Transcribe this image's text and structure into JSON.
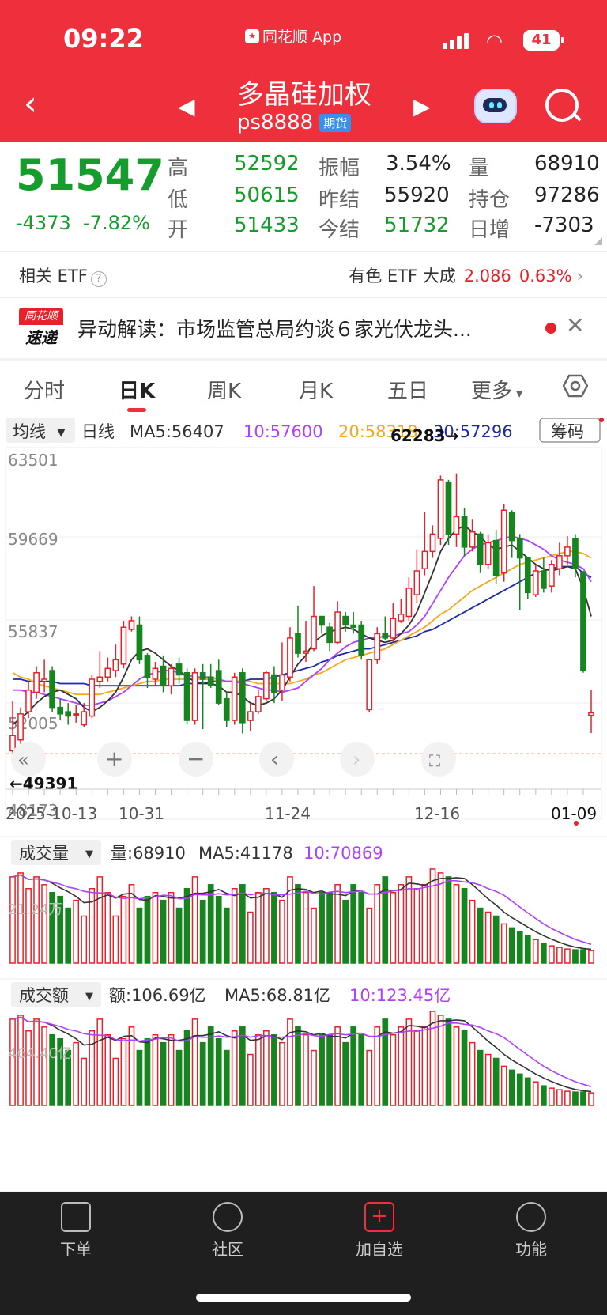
{
  "status": {
    "time": "09:22",
    "app": "同花顺 App",
    "battery": "41"
  },
  "header": {
    "title": "多晶硅加权",
    "code": "ps8888",
    "badge": "期货"
  },
  "quote": {
    "price": "51547",
    "change": "-4373",
    "pct": "-7.82%",
    "rows": [
      {
        "l1": "高",
        "v1": "52592",
        "l2": "振幅",
        "v2": "3.54%",
        "l3": "量",
        "v3": "68910"
      },
      {
        "l1": "低",
        "v1": "50615",
        "l2": "昨结",
        "v2": "55920",
        "l3": "持仓",
        "v3": "97286"
      },
      {
        "l1": "开",
        "v1": "51433",
        "l2": "今结",
        "v2": "51732",
        "l3": "日增",
        "v3": "-7303"
      }
    ]
  },
  "etf": {
    "label": "相关 ETF",
    "name": "有色 ETF 大成",
    "price": "2.086",
    "pct": "0.63%"
  },
  "news": {
    "logo_top": "同花顺",
    "logo_bottom": "速递",
    "text": "异动解读：市场监管总局约谈６家光伏龙头..."
  },
  "tabs": [
    "分时",
    "日K",
    "周K",
    "月K",
    "五日",
    "更多"
  ],
  "ma_bar": {
    "selector": "均线",
    "kind": "日线",
    "ma5": "MA5:56407",
    "ma10": "10:57600",
    "ma20": "20:58318",
    "ma30": "30:57296",
    "chip": "筹码"
  },
  "axis": {
    "y_top": "63501",
    "y2": "59669",
    "y3": "55837",
    "y4": "52005",
    "y_bottom": "48173",
    "hi_label": "62283→",
    "lo_label": "←49391",
    "dates": [
      "2025-10-13",
      "10-31",
      "11-24",
      "12-16",
      "01-09"
    ]
  },
  "volume": {
    "selector": "成交量",
    "value": "量:68910",
    "ma5": "MA5:41178",
    "ma10": "10:70869",
    "scale": "21.24万"
  },
  "amount": {
    "selector": "成交额",
    "value": "额:106.69亿",
    "ma5": "MA5:68.81亿",
    "ma10": "10:123.45亿",
    "scale": "464.40亿"
  },
  "bottom": [
    "下单",
    "社区",
    "加自选",
    "功能"
  ],
  "colors": {
    "up": "#e8202a",
    "down": "#17851f",
    "ma5": "#333333",
    "ma10": "#b040ff",
    "ma20": "#f4a81d",
    "ma30": "#1c2aa8"
  },
  "chart_data": {
    "type": "candlestick",
    "ylim": [
      48173,
      63501
    ],
    "candles": [
      [
        49800,
        50500,
        49391,
        52100
      ],
      [
        50300,
        51500,
        50100,
        51800
      ],
      [
        51600,
        52600,
        51300,
        53000
      ],
      [
        52500,
        53400,
        52200,
        53700
      ],
      [
        53000,
        53100,
        52500,
        54000
      ],
      [
        53500,
        51800,
        51600,
        53700
      ],
      [
        51800,
        51500,
        51200,
        52200
      ],
      [
        51600,
        51400,
        51000,
        52000
      ],
      [
        51500,
        51500,
        51100,
        51900
      ],
      [
        51000,
        51600,
        50900,
        52000
      ],
      [
        51400,
        53100,
        51300,
        53300
      ],
      [
        53000,
        53200,
        52700,
        54400
      ],
      [
        53200,
        53600,
        53000,
        54100
      ],
      [
        53500,
        54000,
        53200,
        54700
      ],
      [
        53800,
        55500,
        53600,
        55800
      ],
      [
        55400,
        55800,
        55300,
        56000
      ],
      [
        55600,
        54000,
        53800,
        56000
      ],
      [
        54200,
        53200,
        52700,
        54300
      ],
      [
        53100,
        53600,
        52800,
        53900
      ],
      [
        53700,
        52800,
        52500,
        54200
      ],
      [
        52800,
        53600,
        52400,
        53800
      ],
      [
        53800,
        53300,
        52900,
        54100
      ],
      [
        53400,
        51200,
        51000,
        53600
      ],
      [
        51200,
        53400,
        51000,
        53600
      ],
      [
        53400,
        53100,
        50800,
        53800
      ],
      [
        53200,
        52800,
        52700,
        53800
      ],
      [
        53500,
        52000,
        51900,
        54000
      ],
      [
        52200,
        51200,
        50900,
        52500
      ],
      [
        51200,
        53200,
        51000,
        53400
      ],
      [
        53400,
        51100,
        50600,
        53600
      ],
      [
        51200,
        51600,
        50700,
        52000
      ],
      [
        51600,
        52300,
        51500,
        52600
      ],
      [
        52200,
        53400,
        52100,
        53500
      ],
      [
        53300,
        52500,
        52000,
        53700
      ],
      [
        52600,
        53300,
        52100,
        54800
      ],
      [
        53200,
        55000,
        53000,
        55500
      ],
      [
        55200,
        54300,
        54100,
        56500
      ],
      [
        54300,
        54400,
        53900,
        55800
      ],
      [
        54500,
        56000,
        54400,
        57400
      ],
      [
        56000,
        55600,
        55200,
        56000
      ],
      [
        55500,
        54800,
        54400,
        55700
      ],
      [
        54800,
        56200,
        54700,
        56700
      ],
      [
        56000,
        55600,
        55300,
        56200
      ],
      [
        55600,
        55500,
        55200,
        56200
      ],
      [
        55600,
        54200,
        54000,
        55800
      ],
      [
        51700,
        54000,
        51600,
        54000
      ],
      [
        54000,
        55200,
        53800,
        55500
      ],
      [
        55200,
        55000,
        54900,
        56000
      ],
      [
        55000,
        55900,
        54800,
        56600
      ],
      [
        55800,
        56100,
        55700,
        56800
      ],
      [
        56000,
        57300,
        55800,
        57800
      ],
      [
        57000,
        58100,
        56600,
        59100
      ],
      [
        58200,
        59000,
        57900,
        60800
      ],
      [
        59000,
        59800,
        58700,
        60200
      ],
      [
        59600,
        62300,
        59300,
        62500
      ],
      [
        62200,
        59800,
        59300,
        62300
      ],
      [
        59800,
        60600,
        59200,
        62600
      ],
      [
        60600,
        59200,
        58800,
        61000
      ],
      [
        59200,
        59900,
        59000,
        60500
      ],
      [
        59800,
        58400,
        58000,
        59900
      ],
      [
        58400,
        59400,
        58200,
        59800
      ],
      [
        59500,
        57900,
        57500,
        60000
      ],
      [
        58000,
        60900,
        57600,
        61200
      ],
      [
        60800,
        59500,
        58700,
        60900
      ],
      [
        59600,
        58700,
        56300,
        59800
      ],
      [
        58700,
        57100,
        56800,
        58700
      ],
      [
        57000,
        58100,
        56900,
        58400
      ],
      [
        58100,
        57300,
        57100,
        58700
      ],
      [
        57400,
        58400,
        57100,
        58600
      ],
      [
        58200,
        58800,
        57900,
        59400
      ],
      [
        58800,
        59200,
        58400,
        59700
      ],
      [
        59600,
        58200,
        57800,
        59800
      ],
      [
        58000,
        53500,
        53400,
        58100
      ],
      [
        51433,
        51547,
        50615,
        52592
      ]
    ],
    "ma5": [
      51000,
      51300,
      51600,
      52000,
      52300,
      52500,
      52600,
      52400,
      52200,
      51800,
      51600,
      51800,
      52100,
      52500,
      53200,
      54000,
      54400,
      54500,
      54300,
      54000,
      53700,
      53500,
      53200,
      53000,
      52900,
      52900,
      52800,
      52500,
      52500,
      52300,
      52000,
      51900,
      52000,
      52200,
      52600,
      53200,
      53800,
      54200,
      54800,
      55100,
      55300,
      55400,
      55500,
      55400,
      55200,
      55000,
      54900,
      54800,
      54900,
      55200,
      55600,
      56200,
      57100,
      58000,
      59000,
      59600,
      60000,
      60200,
      59900,
      59700,
      59300,
      59100,
      59200,
      59300,
      59000,
      58700,
      58400,
      58200,
      58100,
      58200,
      58300,
      58200,
      57300,
      56000
    ],
    "ma10": [
      52600,
      52600,
      52500,
      52500,
      52400,
      52300,
      52200,
      52100,
      52000,
      51900,
      51900,
      52000,
      52100,
      52300,
      52500,
      52800,
      53100,
      53300,
      53400,
      53500,
      53500,
      53400,
      53300,
      53200,
      53200,
      53200,
      53100,
      53000,
      53000,
      52900,
      52800,
      52700,
      52600,
      52600,
      52500,
      52600,
      52700,
      53000,
      53300,
      53600,
      54000,
      54300,
      54600,
      54800,
      54900,
      55000,
      55000,
      55100,
      55100,
      55200,
      55300,
      55600,
      56000,
      56600,
      57200,
      57800,
      58300,
      58800,
      59100,
      59300,
      59400,
      59500,
      59600,
      59700,
      59600,
      59500,
      59300,
      59100,
      58800,
      58600,
      58500,
      58400,
      58200,
      57600
    ],
    "ma20": [
      53400,
      53200,
      53100,
      52900,
      52800,
      52700,
      52600,
      52500,
      52400,
      52400,
      52400,
      52400,
      52500,
      52600,
      52700,
      52800,
      52900,
      53000,
      53000,
      53100,
      53100,
      53100,
      53100,
      53100,
      53100,
      53100,
      53000,
      53000,
      53000,
      53000,
      53000,
      52900,
      52900,
      52900,
      52900,
      52900,
      53000,
      53100,
      53300,
      53400,
      53600,
      53800,
      54000,
      54100,
      54200,
      54300,
      54400,
      54500,
      54700,
      54900,
      55100,
      55300,
      55500,
      55800,
      56100,
      56300,
      56600,
      56900,
      57200,
      57400,
      57600,
      57800,
      58000,
      58200,
      58400,
      58500,
      58600,
      58700,
      58800,
      58900,
      59000,
      59000,
      58900,
      58700
    ],
    "ma30": [
      53100,
      53100,
      53000,
      53000,
      53000,
      53000,
      52900,
      52900,
      52900,
      52900,
      52800,
      52800,
      52800,
      52800,
      52800,
      52800,
      52800,
      52800,
      52800,
      52800,
      52800,
      52800,
      52900,
      52900,
      52900,
      53000,
      53000,
      53000,
      53000,
      53000,
      53100,
      53100,
      53100,
      53200,
      53300,
      53400,
      53500,
      53600,
      53700,
      53900,
      54000,
      54200,
      54300,
      54400,
      54500,
      54500,
      54600,
      54700,
      54800,
      54900,
      55000,
      55100,
      55300,
      55400,
      55600,
      55800,
      56000,
      56200,
      56400,
      56600,
      56800,
      57000,
      57200,
      57400,
      57600,
      57800,
      58000,
      58100,
      58200,
      58300,
      58300,
      58300,
      58000,
      57800
    ],
    "volume": [
      110,
      115,
      95,
      110,
      100,
      90,
      85,
      70,
      80,
      60,
      95,
      110,
      90,
      60,
      85,
      100,
      70,
      85,
      90,
      80,
      90,
      70,
      95,
      110,
      80,
      100,
      85,
      70,
      95,
      100,
      65,
      90,
      95,
      90,
      80,
      110,
      100,
      90,
      70,
      90,
      90,
      100,
      80,
      100,
      90,
      70,
      100,
      110,
      90,
      100,
      110,
      95,
      100,
      120,
      115,
      110,
      100,
      95,
      80,
      70,
      65,
      60,
      50,
      45,
      40,
      35,
      30,
      25,
      22,
      20,
      18,
      17,
      17,
      16
    ],
    "amount": [
      110,
      115,
      95,
      110,
      100,
      90,
      85,
      70,
      80,
      60,
      95,
      110,
      90,
      60,
      85,
      100,
      70,
      85,
      90,
      80,
      90,
      70,
      95,
      110,
      80,
      100,
      85,
      70,
      95,
      100,
      65,
      90,
      95,
      90,
      80,
      110,
      100,
      90,
      70,
      90,
      90,
      100,
      80,
      100,
      90,
      70,
      100,
      110,
      90,
      100,
      110,
      95,
      100,
      120,
      115,
      110,
      100,
      95,
      80,
      70,
      65,
      60,
      50,
      45,
      40,
      35,
      30,
      25,
      22,
      20,
      18,
      17,
      17,
      16
    ]
  }
}
